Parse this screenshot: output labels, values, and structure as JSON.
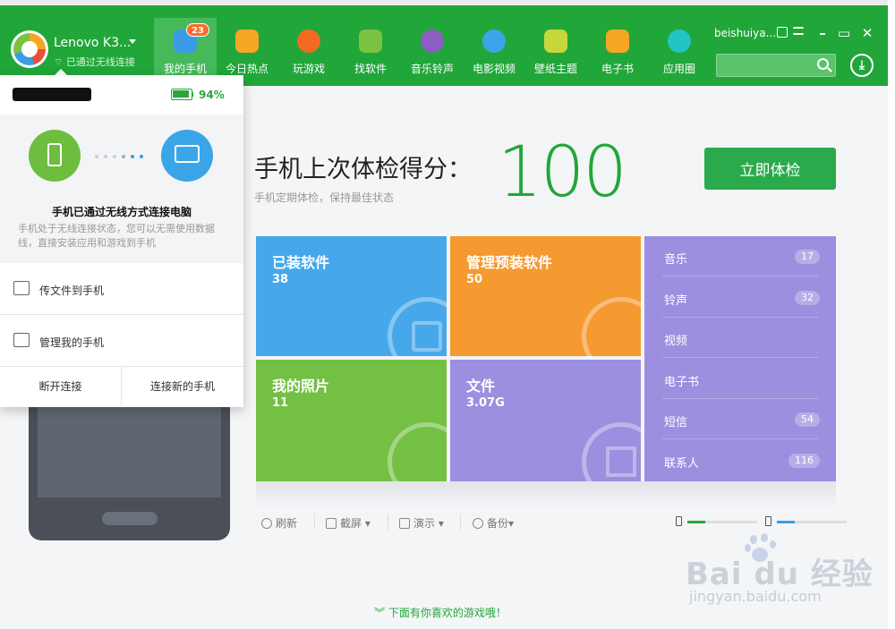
{
  "window": {
    "device_name": "Lenovo K3...",
    "connection_status": "已通过无线连接",
    "username": "beishuiya...",
    "search_placeholder": ""
  },
  "nav": [
    {
      "label": "我的手机",
      "icon": "phone-icon",
      "color": "#3a9ce4",
      "badge": "23",
      "active": true
    },
    {
      "label": "今日热点",
      "icon": "star-icon",
      "color": "#f5a623"
    },
    {
      "label": "玩游戏",
      "icon": "gamepad-icon",
      "color": "#f26b21"
    },
    {
      "label": "找软件",
      "icon": "android-icon",
      "color": "#7cc242"
    },
    {
      "label": "音乐铃声",
      "icon": "music-icon",
      "color": "#8e5cc5"
    },
    {
      "label": "电影视频",
      "icon": "play-icon",
      "color": "#3aa5e8"
    },
    {
      "label": "壁纸主题",
      "icon": "wallpaper-icon",
      "color": "#c7d63a"
    },
    {
      "label": "电子书",
      "icon": "book-icon",
      "color": "#f5a623"
    },
    {
      "label": "应用圈",
      "icon": "circle-icon",
      "color": "#22c4c4"
    }
  ],
  "dropdown": {
    "device_label": "",
    "battery_percent": "94%",
    "battery_level": 0.94,
    "hero_title": "手机已通过无线方式连接电脑",
    "hero_desc": "手机处于无线连接状态，您可以无需使用数据线，直接安装应用和游戏到手机",
    "items": [
      {
        "label": "传文件到手机",
        "icon": "upload-file-icon"
      },
      {
        "label": "管理我的手机",
        "icon": "phone-manage-icon"
      }
    ],
    "disconnect_label": "断开连接",
    "connect_new_label": "连接新的手机"
  },
  "checkup": {
    "title": "手机上次体检得分：",
    "score": "100",
    "subtitle": "手机定期体检，保持最佳状态",
    "button_label": "立即体检"
  },
  "tiles": [
    {
      "title": "已装软件",
      "count": "38",
      "color": "#46a8ea"
    },
    {
      "title": "管理预装软件",
      "count": "50",
      "color": "#f59a30"
    },
    {
      "title": "我的照片",
      "count": "11",
      "color": "#74c045"
    },
    {
      "title": "文件",
      "count": "3.07G",
      "color": "#9c8fe0"
    }
  ],
  "media": [
    {
      "label": "音乐",
      "count": "17"
    },
    {
      "label": "铃声",
      "count": "32"
    },
    {
      "label": "视频",
      "count": ""
    },
    {
      "label": "电子书",
      "count": ""
    },
    {
      "label": "短信",
      "count": "54"
    },
    {
      "label": "联系人",
      "count": "116"
    }
  ],
  "toolbar": {
    "refresh": "刷新",
    "screenshot": "截屏",
    "demo": "演示",
    "backup": "备份"
  },
  "storage": {
    "phone_used": 0.25,
    "sd_used": 0.25,
    "phone_color": "#2aa53b",
    "sd_color": "#3a9ce4"
  },
  "hint": "下面有你喜欢的游戏哦！",
  "watermark": {
    "text": "Bai du 经验",
    "url": "jingyan.baidu.com"
  }
}
